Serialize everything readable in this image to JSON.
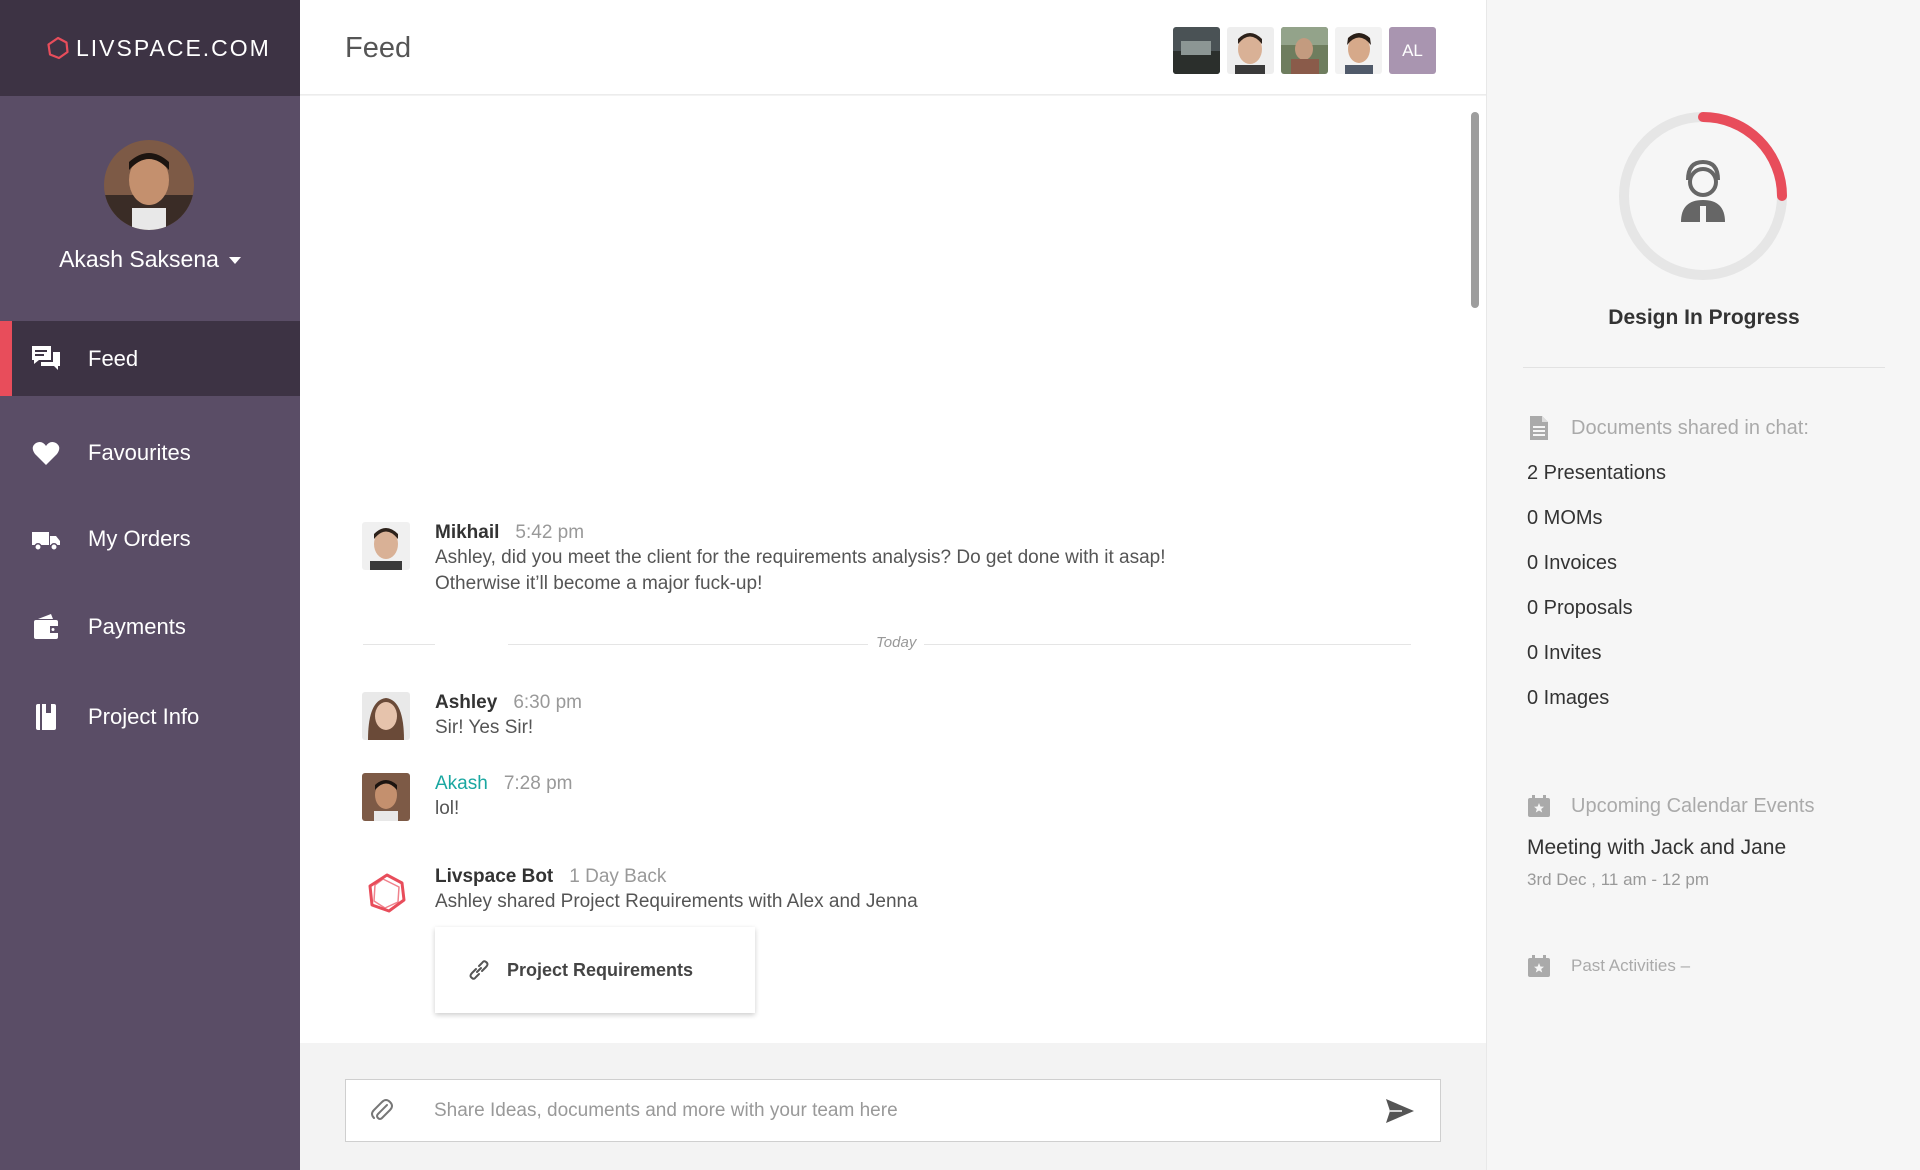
{
  "brand": {
    "name": "LIVSPACE.COM"
  },
  "user": {
    "name": "Akash Saksena"
  },
  "nav": [
    {
      "label": "Feed",
      "icon": "chat-bubbles-icon",
      "active": true
    },
    {
      "label": "Favourites",
      "icon": "heart-icon"
    },
    {
      "label": "My Orders",
      "icon": "truck-icon"
    },
    {
      "label": "Payments",
      "icon": "wallet-icon"
    },
    {
      "label": "Project Info",
      "icon": "book-icon"
    }
  ],
  "header": {
    "title": "Feed",
    "member_initials": "AL"
  },
  "messages": [
    {
      "author": "Mikhail",
      "time": "5:42 pm",
      "lines": [
        "Ashley, did you meet the client for the requirements analysis? Do get done with it asap!",
        "Otherwise it’ll become a major fuck-up!"
      ]
    },
    {
      "author": "Ashley",
      "time": "6:30 pm",
      "lines": [
        "Sir! Yes Sir!"
      ]
    },
    {
      "author": "Akash",
      "time": "7:28 pm",
      "lines": [
        "lol!"
      ]
    },
    {
      "author": "Livspace Bot",
      "time": "1 Day Back",
      "lines": [
        "Ashley shared Project Requirements with Alex and Jenna"
      ],
      "attachment": "Project Requirements"
    }
  ],
  "divider_label": "Today",
  "composer": {
    "placeholder": "Share Ideas, documents and more with your team here"
  },
  "right_panel": {
    "status": "Design In Progress",
    "status_progress": 0.25,
    "accent_color": "#e84d5b",
    "documents_heading": "Documents shared in chat:",
    "documents": [
      "2 Presentations",
      "0 MOMs",
      "0 Invoices",
      "0 Proposals",
      "0 Invites",
      "0 Images"
    ],
    "calendar_heading": "Upcoming Calendar Events",
    "event_title": "Meeting with Jack and Jane",
    "event_time": "3rd Dec , 11 am - 12 pm",
    "past_heading": "Past Activities  –"
  }
}
